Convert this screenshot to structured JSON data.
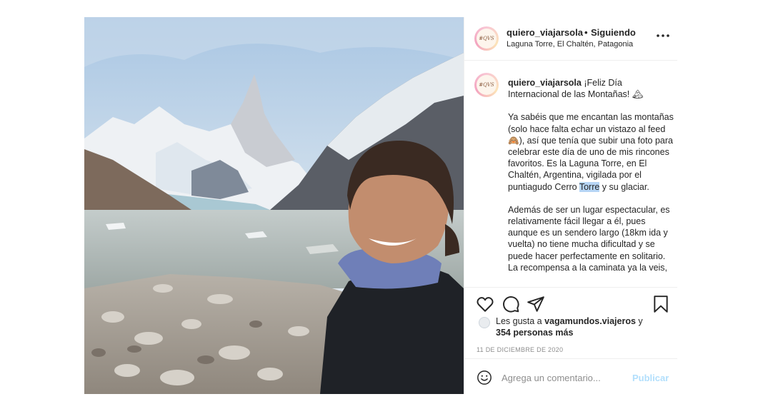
{
  "post": {
    "username": "quiero_viajarsola",
    "separator": "•",
    "follow_status": "Siguiendo",
    "location": "Laguna Torre, El Chaltén, Patagonia",
    "avatar_text": "#QVS",
    "more_icon": "ellipsis-icon"
  },
  "caption": {
    "username": "quiero_viajarsola",
    "intro": "¡Feliz Día Internacional de las Montañas! 🏔",
    "p2_before": "Ya sabéis que me encantan las montañas (solo hace falta echar un vistazo al feed 🙈), así que tenía que subir una foto para celebrar este día de uno de mis rincones favoritos. Es la Laguna Torre, en El Chaltén, Argentina, vigilada por el puntiagudo Cerro ",
    "p2_highlight": "Torre",
    "p2_after": " y su glaciar.",
    "p3": "Además de ser un lugar espectacular, es relativamente fácil llegar a él, pues aunque es un sendero largo (18km ida y vuelta) no tiene mucha dificultad y se puede hacer perfectamente en solitario. La recompensa a la caminata ya la veis,"
  },
  "actions": {
    "like_icon": "heart-icon",
    "comment_icon": "comment-icon",
    "share_icon": "paper-plane-icon",
    "save_icon": "bookmark-icon"
  },
  "likes": {
    "prefix": "Les gusta a ",
    "user": "vagamundos.viajeros",
    "middle": " y",
    "others": "354 personas más"
  },
  "date": "11 DE DICIEMBRE DE 2020",
  "comment": {
    "placeholder": "Agrega un comentario...",
    "post_label": "Publicar",
    "emoji_icon": "smiley-icon"
  },
  "colors": {
    "accent_disabled": "#b2dffc",
    "muted": "#8e8e8e",
    "text": "#262626"
  }
}
